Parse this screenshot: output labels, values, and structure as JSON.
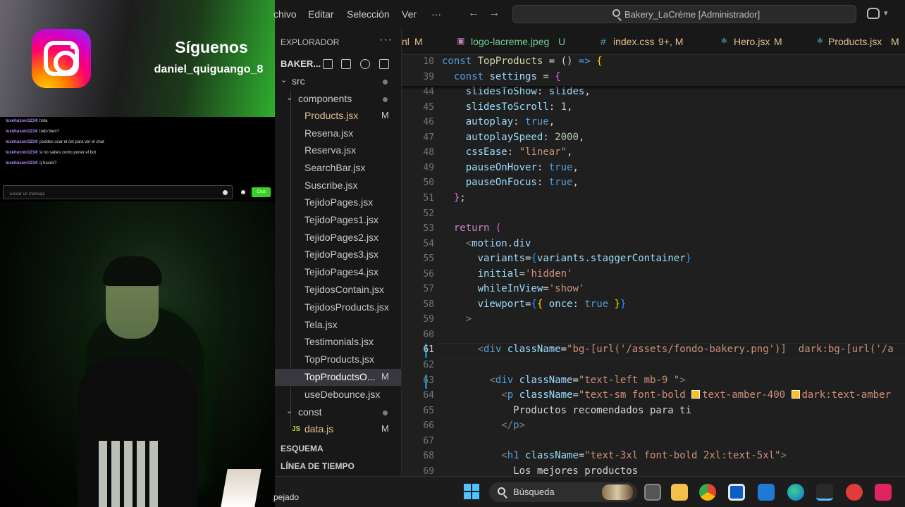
{
  "overlay": {
    "follow_title": "Síguenos",
    "follow_handle": "daniel_quiguango_8",
    "chat": [
      {
        "user": "luxehuzoni1234",
        "text": "hola"
      },
      {
        "user": "luxehuzoni1234",
        "text": "todo bien?"
      },
      {
        "user": "luxehuzoni1234",
        "text": "puedes usar el cel para ver el chat"
      },
      {
        "user": "luxehuzoni1234",
        "text": "si no sabes como poner el bot"
      },
      {
        "user": "luxehuzoni1234",
        "text": "q haces?"
      }
    ],
    "chat_placeholder": "Enviar un mensaje",
    "chat_button": "Chat"
  },
  "menubar": {
    "items": [
      "chivo",
      "Editar",
      "Selección",
      "Ver",
      "···"
    ],
    "command_center": "Bakery_LaCréme [Administrador]"
  },
  "sidebar": {
    "title": "EXPLORADOR",
    "project": "BAKER...",
    "folders": {
      "components": "components",
      "src": "src",
      "const": "const"
    },
    "files": [
      {
        "name": "Products.jsx",
        "badge": "M",
        "state": "mod"
      },
      {
        "name": "Resena.jsx",
        "badge": "",
        "state": "plain"
      },
      {
        "name": "Reserva.jsx",
        "badge": "",
        "state": "plain"
      },
      {
        "name": "SearchBar.jsx",
        "badge": "",
        "state": "plain"
      },
      {
        "name": "Suscribe.jsx",
        "badge": "",
        "state": "plain"
      },
      {
        "name": "TejidoPages.jsx",
        "badge": "",
        "state": "plain"
      },
      {
        "name": "TejidoPages1.jsx",
        "badge": "",
        "state": "plain"
      },
      {
        "name": "TejidoPages2.jsx",
        "badge": "",
        "state": "plain"
      },
      {
        "name": "TejidoPages3.jsx",
        "badge": "",
        "state": "plain"
      },
      {
        "name": "TejidoPages4.jsx",
        "badge": "",
        "state": "plain"
      },
      {
        "name": "TejidosContain.jsx",
        "badge": "",
        "state": "plain"
      },
      {
        "name": "TejidosProducts.jsx",
        "badge": "",
        "state": "plain"
      },
      {
        "name": "Tela.jsx",
        "badge": "",
        "state": "plain"
      },
      {
        "name": "Testimonials.jsx",
        "badge": "",
        "state": "plain"
      },
      {
        "name": "TopProducts.jsx",
        "badge": "",
        "state": "plain"
      },
      {
        "name": "TopProductsO...",
        "badge": "M",
        "state": "selected"
      },
      {
        "name": "useDebounce.jsx",
        "badge": "",
        "state": "plain"
      }
    ],
    "const_file": {
      "name": "data.js",
      "badge": "M",
      "icon": "JS"
    },
    "outline": "ESQUEMA",
    "timeline": "LÍNEA DE TIEMPO"
  },
  "tabs": [
    {
      "name": "nl",
      "badge": "M",
      "icon": ""
    },
    {
      "name": "logo-lacreme.jpeg",
      "badge": "U",
      "icon": "image-icon"
    },
    {
      "name": "index.css",
      "badge": "9+, M",
      "icon": "hash-icon"
    },
    {
      "name": "Hero.jsx",
      "badge": "M",
      "icon": "react-icon"
    },
    {
      "name": "Products.jsx",
      "badge": "M",
      "icon": "react-icon"
    }
  ],
  "editor": {
    "active_line": "61",
    "lines": [
      {
        "n": "10",
        "html": "<span class='k-kw'>const</span> <span class='k-fn'>TopProducts</span> = () <span class='k-kw'>=&gt;</span> <span class='k-brace'>{</span>"
      },
      {
        "n": "39",
        "html": "  <span class='k-kw'>const</span> <span class='k-var'>settings</span> = <span class='k-brace2'>{</span>"
      },
      {
        "n": "44",
        "html": "    <span class='k-var'>slidesToShow</span>: <span class='k-var'>slides</span>,"
      },
      {
        "n": "45",
        "html": "    <span class='k-var'>slidesToScroll</span>: <span class='k-num'>1</span>,"
      },
      {
        "n": "46",
        "html": "    <span class='k-var'>autoplay</span>: <span class='k-kw'>true</span>,"
      },
      {
        "n": "47",
        "html": "    <span class='k-var'>autoplaySpeed</span>: <span class='k-num'>2000</span>,"
      },
      {
        "n": "48",
        "html": "    <span class='k-var'>cssEase</span>: <span class='k-str'>\"linear\"</span>,"
      },
      {
        "n": "49",
        "html": "    <span class='k-var'>pauseOnHover</span>: <span class='k-kw'>true</span>,"
      },
      {
        "n": "50",
        "html": "    <span class='k-var'>pauseOnFocus</span>: <span class='k-kw'>true</span>,"
      },
      {
        "n": "51",
        "html": "  <span class='k-brace2'>}</span>;"
      },
      {
        "n": "52",
        "html": ""
      },
      {
        "n": "53",
        "html": "  <span class='k-ctl'>return</span> <span class='k-brace2'>(</span>"
      },
      {
        "n": "54",
        "html": "    <span class='k-tag'>&lt;</span><span class='k-var'>motion</span>.<span class='k-var'>div</span>"
      },
      {
        "n": "55",
        "html": "      <span class='k-var'>variants</span>=<span class='k-brace3'>{</span><span class='k-var'>variants</span>.<span class='k-var'>staggerContainer</span><span class='k-brace3'>}</span>"
      },
      {
        "n": "56",
        "html": "      <span class='k-var'>initial</span>=<span class='k-str'>'hidden'</span>"
      },
      {
        "n": "57",
        "html": "      <span class='k-var'>whileInView</span>=<span class='k-str'>'show'</span>"
      },
      {
        "n": "58",
        "html": "      <span class='k-var'>viewport</span>=<span class='k-brace3'>{</span><span class='k-brace'>{</span> <span class='k-var'>once</span>: <span class='k-kw'>true</span> <span class='k-brace'>}</span><span class='k-brace3'>}</span>"
      },
      {
        "n": "59",
        "html": "    <span class='k-tag'>&gt;</span>"
      },
      {
        "n": "60",
        "html": ""
      },
      {
        "n": "61",
        "html": "      <span class='k-tag'>&lt;</span><span class='k-kw'>div</span> <span class='k-var'>className</span>=<span class='k-str'>\"bg-[url('/assets/fondo-bakery.png')]  dark:bg-[url('/a</span>"
      },
      {
        "n": "62",
        "html": ""
      },
      {
        "n": "63",
        "html": "        <span class='k-tag'>&lt;</span><span class='k-kw'>div</span> <span class='k-var'>className</span>=<span class='k-str'>\"text-left mb-9 \"</span><span class='k-tag'>&gt;</span>"
      },
      {
        "n": "64",
        "html": "          <span class='k-tag'>&lt;</span><span class='k-kw'>p</span> <span class='k-var'>className</span>=<span class='k-str'>\"text-sm font-bold <span class='swatch'></span>text-amber-400 <span class='swatch'></span>dark:text-amber</span>"
      },
      {
        "n": "65",
        "html": "            Productos recomendados para ti"
      },
      {
        "n": "66",
        "html": "          <span class='k-tag'>&lt;/</span><span class='k-kw'>p</span><span class='k-tag'>&gt;</span>"
      },
      {
        "n": "67",
        "html": ""
      },
      {
        "n": "68",
        "html": "          <span class='k-tag'>&lt;</span><span class='k-kw'>h1</span> <span class='k-var'>className</span>=<span class='k-str'>\"text-3xl font-bold 2xl:text-5xl\"</span><span class='k-tag'>&gt;</span>"
      },
      {
        "n": "69",
        "html": "            Los mejores productos"
      }
    ]
  },
  "taskbar": {
    "status_left": "pejado",
    "search_label": "Búsqueda"
  },
  "colors": {
    "modified": "#e2c08d",
    "accent_green": "#34d321",
    "vscode_bg": "#1f1f1f"
  }
}
